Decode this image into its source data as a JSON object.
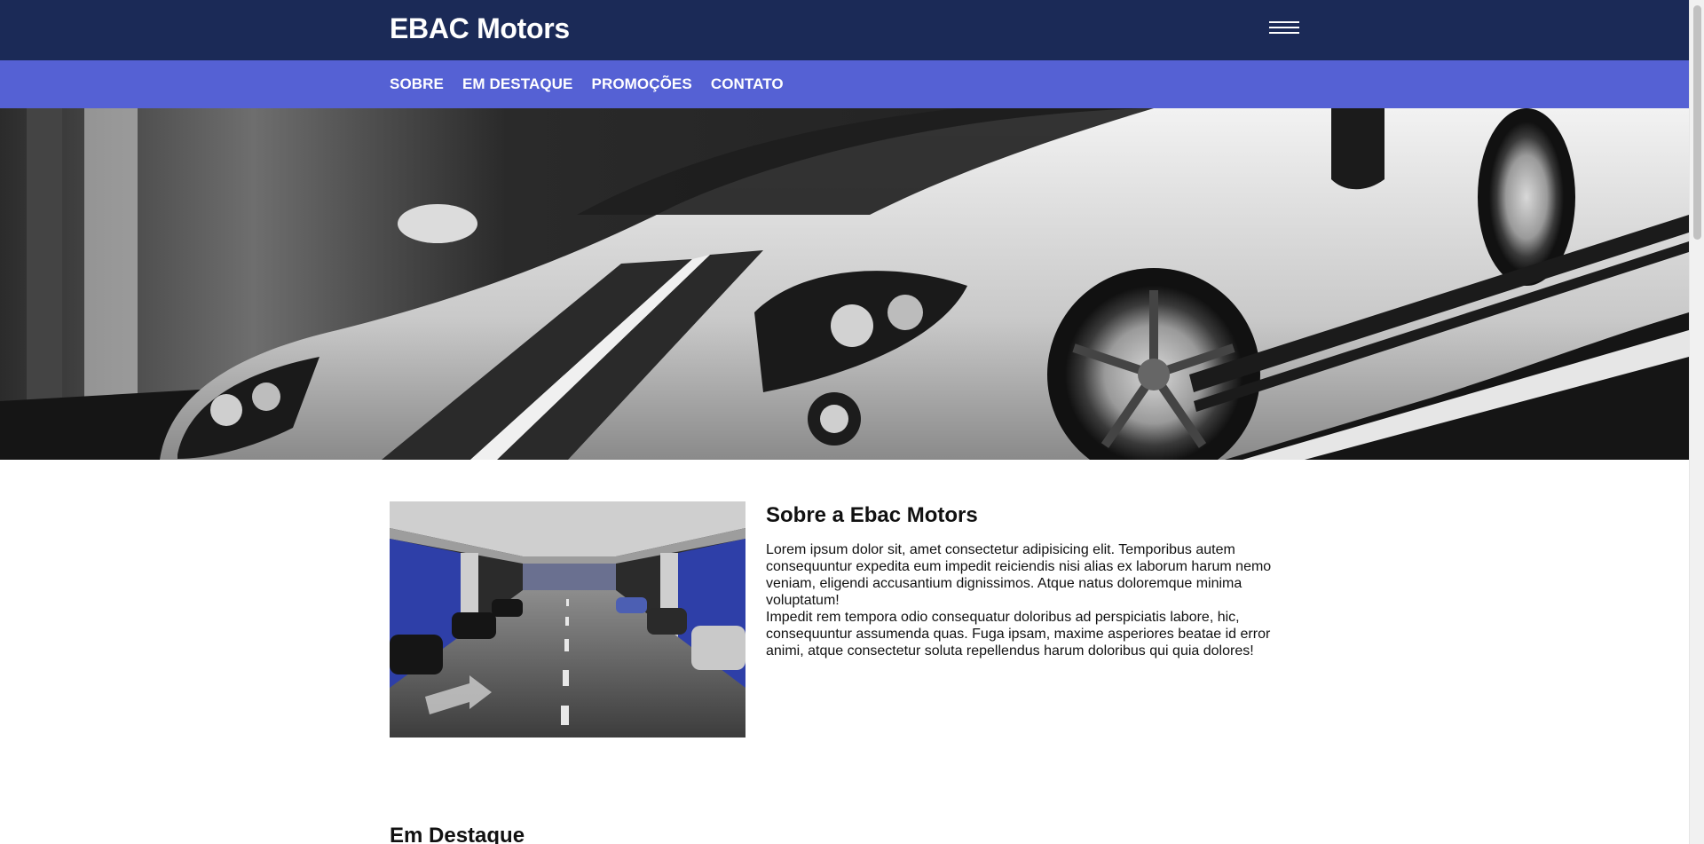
{
  "header": {
    "brand": "EBAC Motors",
    "menu_icon": "hamburger-menu-icon",
    "background_color": "#1b2a57"
  },
  "nav": {
    "background_color": "#5561d4",
    "items": [
      {
        "label": "SOBRE"
      },
      {
        "label": "EM DESTAQUE"
      },
      {
        "label": "PROMOÇÕES"
      },
      {
        "label": "CONTATO"
      }
    ]
  },
  "about": {
    "title": "Sobre a Ebac Motors",
    "paragraph1": "Lorem ipsum dolor sit, amet consectetur adipisicing elit. Temporibus autem consequuntur expedita eum impedit reiciendis nisi alias ex laborum harum nemo veniam, eligendi accusantium dignissimos. Atque natus doloremque minima voluptatum!",
    "paragraph2": "Impedit rem tempora odio consequatur doloribus ad perspiciatis labore, hic, consequuntur assumenda quas. Fuga ipsam, maxime asperiores beatae id error animi, atque consectetur soluta repellendus harum doloribus qui quia dolores!"
  },
  "featured": {
    "title": "Em Destaque"
  }
}
